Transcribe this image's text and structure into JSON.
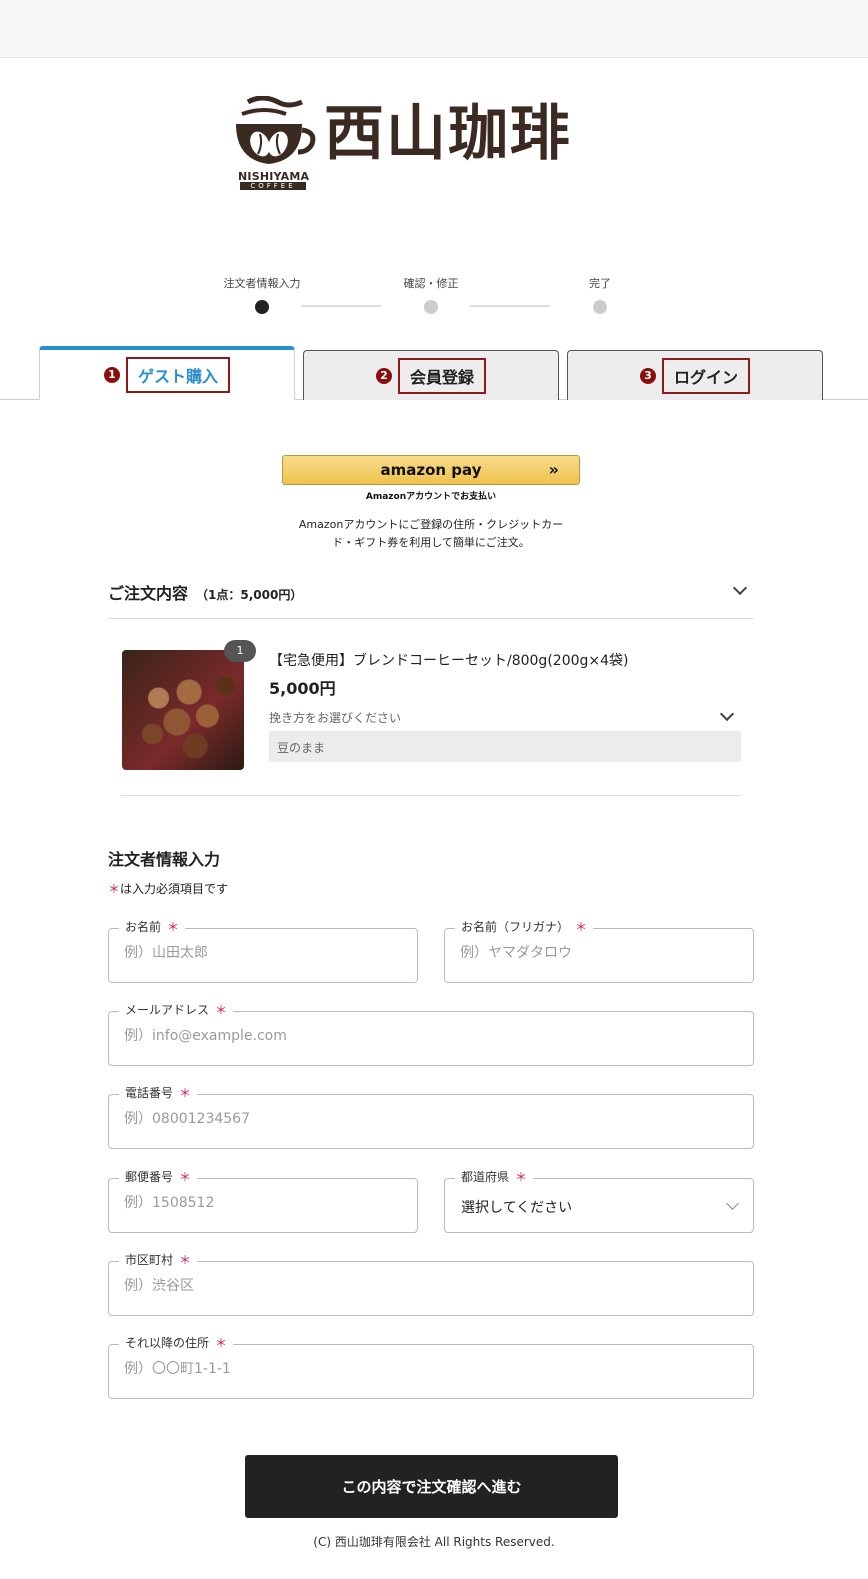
{
  "brand": {
    "name": "西山珈琲",
    "sub": "NISHIYAMA",
    "sub2": "COFFEE"
  },
  "steps": [
    {
      "label": "注文者情報入力",
      "active": true
    },
    {
      "label": "確認・修正",
      "active": false
    },
    {
      "label": "完了",
      "active": false
    }
  ],
  "tabs": [
    {
      "num": "1",
      "label": "ゲスト購入",
      "active": true
    },
    {
      "num": "2",
      "label": "会員登録",
      "active": false
    },
    {
      "num": "3",
      "label": "ログイン",
      "active": false
    }
  ],
  "amazon": {
    "button_label": "amazon pay",
    "button_arrow": "»",
    "sub": "Amazonアカウントでお支払い",
    "desc": "Amazonアカウントにご登録の住所・クレジットカード・ギフト券を利用して簡単にご注文。"
  },
  "order": {
    "title": "ご注文内容",
    "summary": "（1点：5,000円）",
    "item": {
      "qty": "1",
      "name": "【宅急便用】ブレンドコーヒーセット/800g(200g×4袋)",
      "price": "5,000円",
      "grind_label": "挽き方をお選びください",
      "grind_value": "豆のまま"
    }
  },
  "form": {
    "title": "注文者情報入力",
    "required_mark": "＊",
    "required_note": "は入力必須項目です",
    "fields": {
      "name": {
        "label": "お名前",
        "placeholder": "例）山田太郎"
      },
      "kana": {
        "label": "お名前（フリガナ）",
        "placeholder": "例）ヤマダタロウ"
      },
      "email": {
        "label": "メールアドレス",
        "placeholder": "例）info@example.com"
      },
      "tel": {
        "label": "電話番号",
        "placeholder": "例）08001234567"
      },
      "zip": {
        "label": "郵便番号",
        "placeholder": "例）1508512"
      },
      "pref": {
        "label": "都道府県",
        "value": "選択してください"
      },
      "city": {
        "label": "市区町村",
        "placeholder": "例）渋谷区"
      },
      "addr": {
        "label": "それ以降の住所",
        "placeholder": "例）〇〇町1-1-1"
      }
    },
    "submit_label": "この内容で注文確認へ進む"
  },
  "footer": "(C) 西山珈琲有限会社 All Rights Reserved.",
  "colors": {
    "accent": "#2b8ed0",
    "brand": "#3b2a22",
    "tab_badge": "#8b0e0e",
    "required": "#d4145a",
    "button": "#222222"
  }
}
